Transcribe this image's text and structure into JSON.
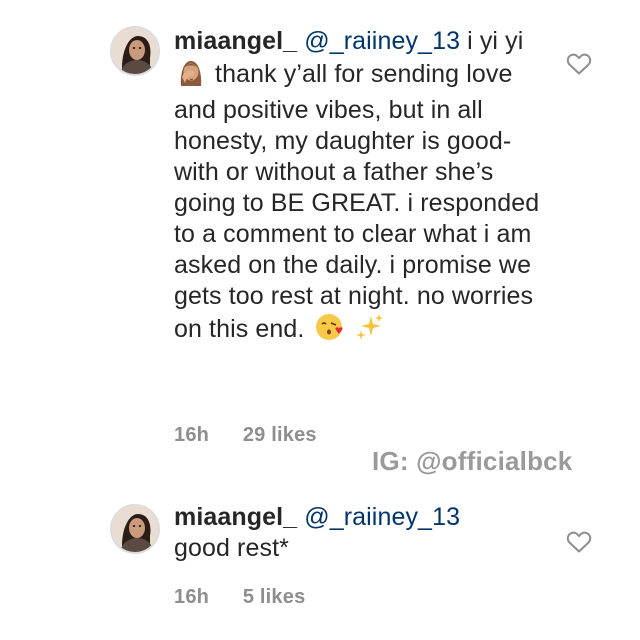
{
  "comments": [
    {
      "username": "miaangel_",
      "mention": "@_raiiney_13",
      "text_before_emoji": "i yi yi",
      "emoji_1": "woman-facepalming-emoji",
      "text_after_emoji": "thank y’all for sending love and positive vibes, but in all honesty, my daughter is good- with or without a father she’s going to BE GREAT. i responded to a comment to clear what i am asked on the daily. i promise we gets too rest at night. no worries on this end.",
      "emoji_2": "face-blowing-kiss-emoji",
      "emoji_3": "sparkles-emoji",
      "time": "16h",
      "likes": "29 likes",
      "like_icon": "heart-outline-icon"
    },
    {
      "username": "miaangel_",
      "mention": "@_raiiney_13",
      "text": "good rest*",
      "time": "16h",
      "likes": "5 likes",
      "like_icon": "heart-outline-icon"
    }
  ],
  "watermark": "IG: @officialbck",
  "colors": {
    "text": "#262626",
    "mention": "#003569",
    "meta": "#8e8e8e",
    "watermark": "#9a9a9a"
  }
}
